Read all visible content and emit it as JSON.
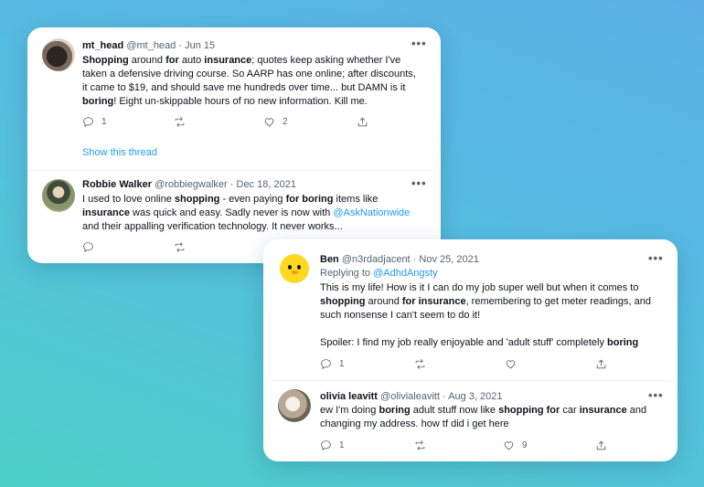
{
  "card_top": {
    "tweet1": {
      "name": "mt_head",
      "handle": "@mt_head",
      "date": "Jun 15",
      "lines": [
        [
          {
            "t": "Shopping",
            "b": true
          },
          {
            "t": " around "
          },
          {
            "t": "for",
            "b": true
          },
          {
            "t": " auto "
          },
          {
            "t": "insurance",
            "b": true
          },
          {
            "t": "; quotes keep asking whether I've"
          }
        ],
        [
          {
            "t": "taken a defensive driving course. So AARP has one online; after discounts,"
          }
        ],
        [
          {
            "t": "it came to $19, and should save me hundreds over time... but DAMN is it"
          }
        ],
        [
          {
            "t": "boring",
            "b": true
          },
          {
            "t": "! Eight un-skippable hours of no new information. Kill me."
          }
        ]
      ],
      "reply_count": "1",
      "like_count": "2",
      "show_thread": "Show this thread"
    },
    "tweet2": {
      "name": "Robbie Walker",
      "handle": "@robbiegwalker",
      "date": "Dec 18, 2021",
      "lines": [
        [
          {
            "t": "I used to love online "
          },
          {
            "t": "shopping",
            "b": true
          },
          {
            "t": " - even paying "
          },
          {
            "t": "for boring",
            "b": true
          },
          {
            "t": " items like"
          }
        ],
        [
          {
            "t": "insurance",
            "b": true
          },
          {
            "t": " was quick and easy. Sadly never is now with "
          },
          {
            "t": "@AskNationwide",
            "m": true
          }
        ],
        [
          {
            "t": "and their appalling verification technology. It never works..."
          }
        ]
      ]
    }
  },
  "card_bottom": {
    "tweet1": {
      "name": "Ben",
      "handle": "@n3rdadjacent",
      "date": "Nov 25, 2021",
      "reply_label": "Replying to ",
      "reply_handle": "@AdhdAngsty",
      "lines": [
        [
          {
            "t": "This is my life! How is it I can do my job super well but when it comes to"
          }
        ],
        [
          {
            "t": "shopping",
            "b": true
          },
          {
            "t": " around "
          },
          {
            "t": "for insurance",
            "b": true
          },
          {
            "t": ", remembering to get meter readings, and"
          }
        ],
        [
          {
            "t": "such nonsense I can't seem to do it!"
          }
        ],
        [],
        [
          {
            "t": "Spoiler: I find my job really enjoyable and 'adult stuff' completely "
          },
          {
            "t": "boring",
            "b": true
          }
        ]
      ],
      "reply_count": "1"
    },
    "tweet2": {
      "name": "olivia leavitt",
      "handle": "@olivialeavitt",
      "date": "Aug 3, 2021",
      "lines": [
        [
          {
            "t": "ew I'm doing "
          },
          {
            "t": "boring",
            "b": true
          },
          {
            "t": " adult stuff now like "
          },
          {
            "t": "shopping for",
            "b": true
          },
          {
            "t": " car "
          },
          {
            "t": "insurance",
            "b": true
          },
          {
            "t": " and"
          }
        ],
        [
          {
            "t": "changing my address. how tf did i get here"
          }
        ]
      ],
      "reply_count": "1",
      "like_count": "9"
    }
  },
  "icons": {
    "reply": "reply-icon",
    "retweet": "retweet-icon",
    "like": "heart-icon",
    "share": "share-icon",
    "more": "more-icon"
  },
  "more_glyph": "•••",
  "separator": " · ",
  "colors": {
    "link": "#1d9bf0",
    "text": "#0f1419",
    "muted": "#536471"
  }
}
